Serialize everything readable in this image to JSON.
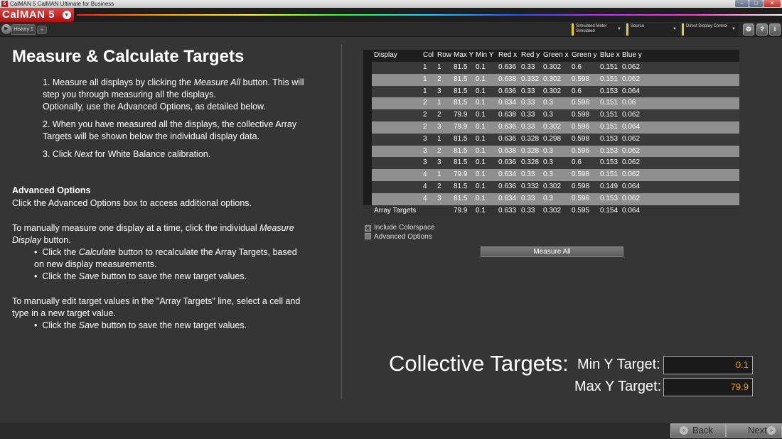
{
  "window": {
    "title": "CalMAN 5 CalMAN Ultimate for Business",
    "app_icon": "5"
  },
  "app": {
    "logo": "CalMAN 5",
    "logo_arrow": "▾"
  },
  "toolbar": {
    "tab_label": "History 1",
    "add_tab": "+",
    "dropdowns": [
      {
        "line1": "Simulated Meter",
        "line2": "Simulated"
      },
      {
        "line1": "Source",
        "line2": ""
      },
      {
        "line1": "Direct Display Control",
        "line2": ""
      }
    ],
    "icons": [
      "gear-icon",
      "help-icon",
      "info-icon"
    ],
    "icon_glyphs": [
      "⚙",
      "?",
      "i"
    ]
  },
  "left": {
    "title": "Measure & Calculate Targets",
    "step1_prefix": "1.  Measure all displays by clicking the ",
    "step1_em": "Measure All",
    "step1_suffix": " button. This will step you through measuring all the displays.",
    "step1_line3": "Optionally, use the Advanced Options, as detailed below.",
    "step2": "2.  When you have measured all the displays, the collective Array Targets will be shown below the individual display data.",
    "step3_prefix": "3.  Click ",
    "step3_em": "Next",
    "step3_suffix": " for White Balance calibration.",
    "adv_heading": "Advanced Options",
    "adv_text": "Click the Advanced Options box to access additional options.",
    "manual1_prefix": "To manually measure one display at a time, click the individual ",
    "manual1_em": "Measure Display",
    "manual1_suffix": " button.",
    "bullet1_prefix": "Click the ",
    "bullet1_em": "Calculate",
    "bullet1_suffix": " button to recalculate the Array Targets, based on new display measurements.",
    "bullet2_prefix": "Click the ",
    "bullet2_em": "Save",
    "bullet2_suffix": " button to save the new target values.",
    "manual2": "To manually edit target values in the \"Array Targets\" line, select a cell and type in a new target value.",
    "bullet3_prefix": "Click the ",
    "bullet3_em": "Save",
    "bullet3_suffix": " button to save the new target values."
  },
  "table": {
    "headers": [
      "Display",
      "Col",
      "Row",
      "Max Y",
      "Min Y",
      "Red x",
      "Red y",
      "Green x",
      "Green y",
      "Blue x",
      "Blue y"
    ],
    "rows": [
      [
        "1",
        "1",
        "81.5",
        "0.1",
        "0.636",
        "0.33",
        "0.302",
        "0.6",
        "0.151",
        "0.062"
      ],
      [
        "1",
        "2",
        "81.5",
        "0.1",
        "0.638",
        "0.332",
        "0.302",
        "0.598",
        "0.151",
        "0.062"
      ],
      [
        "1",
        "3",
        "81.5",
        "0.1",
        "0.636",
        "0.33",
        "0.302",
        "0.6",
        "0.153",
        "0.064"
      ],
      [
        "2",
        "1",
        "81.5",
        "0.1",
        "0.634",
        "0.33",
        "0.3",
        "0.596",
        "0.151",
        "0.06"
      ],
      [
        "2",
        "2",
        "79.9",
        "0.1",
        "0.638",
        "0.33",
        "0.3",
        "0.598",
        "0.151",
        "0.062"
      ],
      [
        "2",
        "3",
        "79.9",
        "0.1",
        "0.636",
        "0.33",
        "0.302",
        "0.596",
        "0.151",
        "0.064"
      ],
      [
        "3",
        "1",
        "81.5",
        "0.1",
        "0.636",
        "0.328",
        "0.298",
        "0.598",
        "0.153",
        "0.062"
      ],
      [
        "3",
        "2",
        "81.5",
        "0.1",
        "0.638",
        "0.328",
        "0.3",
        "0.596",
        "0.153",
        "0.062"
      ],
      [
        "3",
        "3",
        "81.5",
        "0.1",
        "0.636",
        "0.328",
        "0.3",
        "0.6",
        "0.153",
        "0.062"
      ],
      [
        "4",
        "1",
        "79.9",
        "0.1",
        "0.634",
        "0.33",
        "0.3",
        "0.598",
        "0.151",
        "0.062"
      ],
      [
        "4",
        "2",
        "81.5",
        "0.1",
        "0.636",
        "0.332",
        "0.302",
        "0.598",
        "0.149",
        "0.064"
      ],
      [
        "4",
        "3",
        "81.5",
        "0.1",
        "0.634",
        "0.33",
        "0.3",
        "0.596",
        "0.153",
        "0.062"
      ]
    ],
    "footer": {
      "label": "Array Targets",
      "values": [
        "79.9",
        "0.1",
        "0.633",
        "0.33",
        "0.302",
        "0.595",
        "0.154",
        "0.064"
      ]
    }
  },
  "options": {
    "include_colorspace": {
      "label": "Include Colorspace",
      "checked": true,
      "mark": "✕"
    },
    "advanced_options": {
      "label": "Advanced Options",
      "checked": false
    }
  },
  "measure_all_label": "Measure All",
  "collective": {
    "title": "Collective Targets:",
    "min_label": "Min Y Target:",
    "min_value": "0.1",
    "max_label": "Max Y Target:",
    "max_value": "79.9"
  },
  "nav": {
    "back": "Back",
    "next": "Next",
    "back_icon": "«",
    "next_icon": "»"
  },
  "colors": {
    "accent_value": "#f0a020",
    "brand_red": "#c41e1e",
    "dropdown_accent": "#e8d020"
  }
}
